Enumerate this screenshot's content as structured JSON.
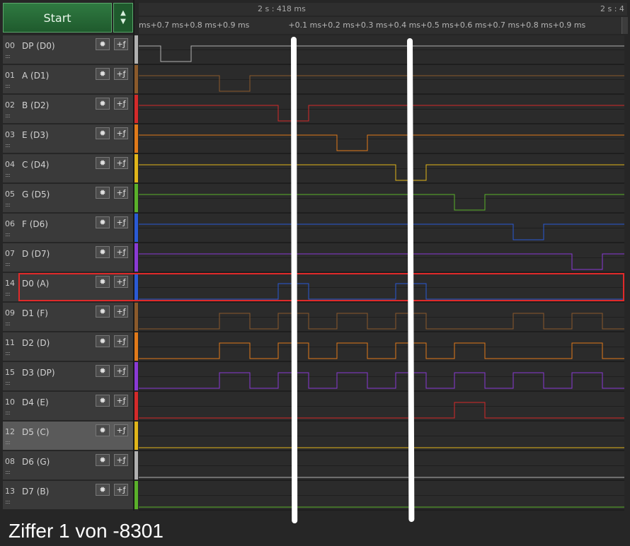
{
  "toolbar": {
    "start_label": "Start",
    "spin_up": "▲",
    "spin_down": "▼"
  },
  "ruler": {
    "center_time": "2 s : 418 ms",
    "right_time": "2 s : 4",
    "ticks_left": "ms+0.7 ms+0.8 ms+0.9 ms",
    "ticks_right": "+0.1 ms+0.2 ms+0.3 ms+0.4 ms+0.5 ms+0.6 ms+0.7 ms+0.8 ms+0.9 ms"
  },
  "icons": {
    "gear": "gear-icon",
    "trigger": "trigger-icon"
  },
  "channels": [
    {
      "num": "00",
      "name": "DP (D0)",
      "color": "#b0b0b0"
    },
    {
      "num": "01",
      "name": "A (D1)",
      "color": "#8b5a2b"
    },
    {
      "num": "02",
      "name": "B (D2)",
      "color": "#d42a2a"
    },
    {
      "num": "03",
      "name": "E (D3)",
      "color": "#e07a1a"
    },
    {
      "num": "04",
      "name": "C (D4)",
      "color": "#e0b51a"
    },
    {
      "num": "05",
      "name": "G (D5)",
      "color": "#5ab02a"
    },
    {
      "num": "06",
      "name": "F (D6)",
      "color": "#2a5ad4"
    },
    {
      "num": "07",
      "name": "D (D7)",
      "color": "#8a3ad4"
    },
    {
      "num": "14",
      "name": "D0 (A)",
      "color": "#2a5ad4"
    },
    {
      "num": "09",
      "name": "D1 (F)",
      "color": "#8b5a2b"
    },
    {
      "num": "11",
      "name": "D2 (D)",
      "color": "#e07a1a"
    },
    {
      "num": "15",
      "name": "D3 (DP)",
      "color": "#8a3ad4"
    },
    {
      "num": "10",
      "name": "D4 (E)",
      "color": "#d42a2a"
    },
    {
      "num": "12",
      "name": "D5 (C)",
      "color": "#e0b51a"
    },
    {
      "num": "08",
      "name": "D6 (G)",
      "color": "#b0b0b0"
    },
    {
      "num": "13",
      "name": "D7 (B)",
      "color": "#5ab02a"
    }
  ],
  "caption": "Ziffer 1 von -8301"
}
